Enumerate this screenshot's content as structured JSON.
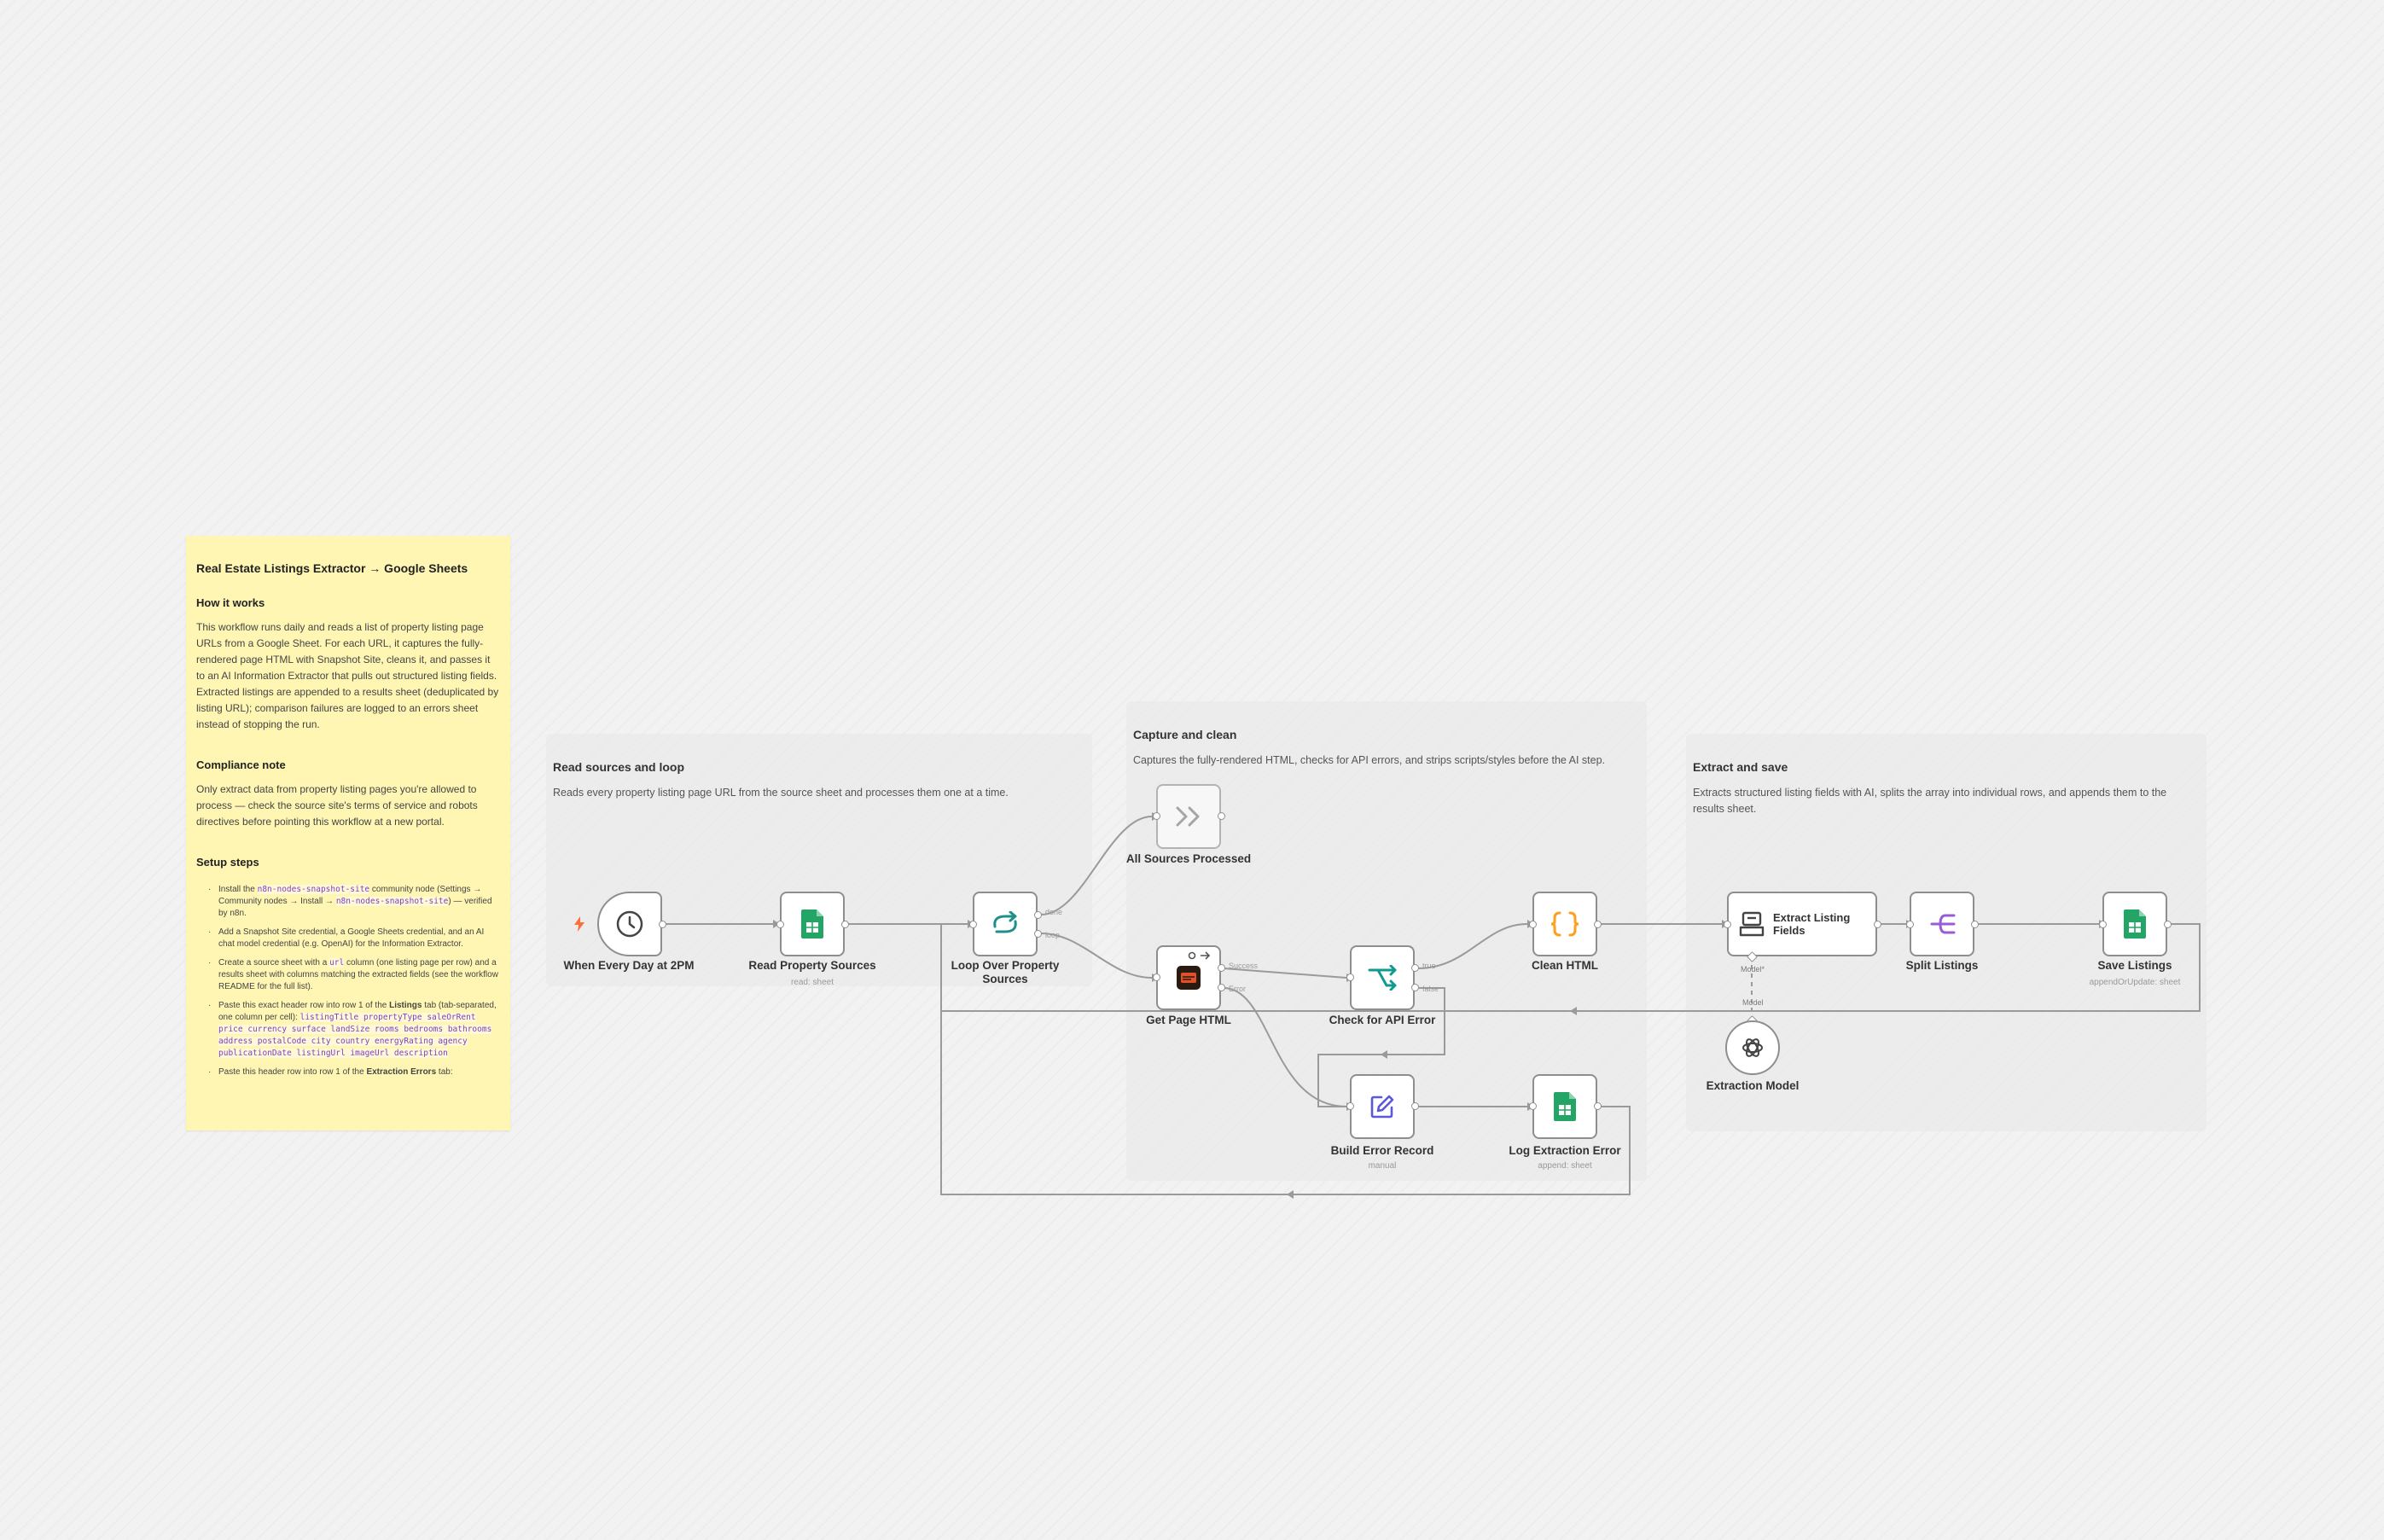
{
  "sticky": {
    "title": "Real Estate Listings Extractor → Google Sheets",
    "how_heading": "How it works",
    "how_text": "This workflow runs daily and reads a list of property listing page URLs from a Google Sheet. For each URL, it captures the fully-rendered page HTML with Snapshot Site, cleans it, and passes it to an AI Information Extractor that pulls out structured listing fields. Extracted listings are appended to a results sheet (deduplicated by listing URL); comparison failures are logged to an errors sheet instead of stopping the run.",
    "compliance_heading": "Compliance note",
    "compliance_text": "Only extract data from property listing pages you're allowed to process — check the source site's terms of service and robots directives before pointing this workflow at a new portal.",
    "setup_heading": "Setup steps",
    "step1_a": "Install the ",
    "step1_code1": "n8n-nodes-snapshot-site",
    "step1_b": " community node (Settings → Community nodes → Install → ",
    "step1_code2": "n8n-nodes-snapshot-site",
    "step1_c": ") — verified by n8n.",
    "step2": "Add a Snapshot Site credential, a Google Sheets credential, and an AI chat model credential (e.g. OpenAI) for the Information Extractor.",
    "step3_a": "Create a source sheet with a ",
    "step3_code": "url",
    "step3_b": " column (one listing page per row) and a results sheet with columns matching the extracted fields (see the workflow README for the full list).",
    "step4_a": "Paste this exact header row into row 1 of the ",
    "step4_bold": "Listings",
    "step4_b": " tab (tab-separated, one column per cell): ",
    "step4_code": "listingTitle propertyType saleOrRent price currency surface landSize rooms bedrooms bathrooms address postalCode city country energyRating agency publicationDate listingUrl imageUrl description",
    "step5_a": "Paste this header row into row 1 of the ",
    "step5_bold": "Extraction Errors",
    "step5_b": " tab:"
  },
  "groups": {
    "read": {
      "title": "Read sources and loop",
      "desc": "Reads every property listing page URL from the source sheet and processes them one at a time."
    },
    "capture": {
      "title": "Capture and clean",
      "desc": "Captures the fully-rendered HTML, checks for API errors, and strips scripts/styles before the AI step."
    },
    "extract": {
      "title": "Extract and save",
      "desc": "Extracts structured listing fields with AI, splits the array into individual rows, and appends them to the results sheet."
    }
  },
  "nodes": {
    "trigger": {
      "label": "When Every Day at 2PM",
      "icon": "clock-icon"
    },
    "read_sources": {
      "label": "Read Property Sources",
      "sub": "read: sheet",
      "icon": "google-sheets-icon"
    },
    "loop": {
      "label": "Loop Over Property Sources",
      "icon": "loop-icon",
      "out_done": "done",
      "out_loop": "loop"
    },
    "all_processed": {
      "label": "All Sources Processed",
      "icon": "no-op-icon"
    },
    "get_html": {
      "label": "Get Page HTML",
      "icon": "snapshot-site-icon",
      "out_success": "Success",
      "out_error": "Error"
    },
    "check_error": {
      "label": "Check for API Error",
      "icon": "if-icon",
      "out_true": "true",
      "out_false": "false"
    },
    "clean_html": {
      "label": "Clean HTML",
      "icon": "code-icon"
    },
    "build_error": {
      "label": "Build Error Record",
      "sub": "manual",
      "icon": "edit-icon"
    },
    "log_error": {
      "label": "Log Extraction Error",
      "sub": "append: sheet",
      "icon": "google-sheets-icon"
    },
    "extract_fields": {
      "label": "Extract Listing Fields",
      "icon": "information-extractor-icon",
      "model_port": "Model*"
    },
    "split": {
      "label": "Split Listings",
      "icon": "split-out-icon"
    },
    "save": {
      "label": "Save Listings",
      "sub": "appendOrUpdate: sheet",
      "icon": "google-sheets-icon"
    },
    "model": {
      "label": "Extraction Model",
      "icon": "openai-icon",
      "model_port": "Model"
    }
  },
  "colors": {
    "sticky_bg": "#fff6b3",
    "sheets_green": "#23a566",
    "loop_teal": "#1f8f8a",
    "code_orange": "#ff9f1c",
    "if_teal": "#0f9b8e",
    "edit_indigo": "#5a59d6",
    "split_purple": "#9a5bd8",
    "trigger_orange": "#ff6d3a",
    "wire_gray": "#9a9a9a"
  }
}
